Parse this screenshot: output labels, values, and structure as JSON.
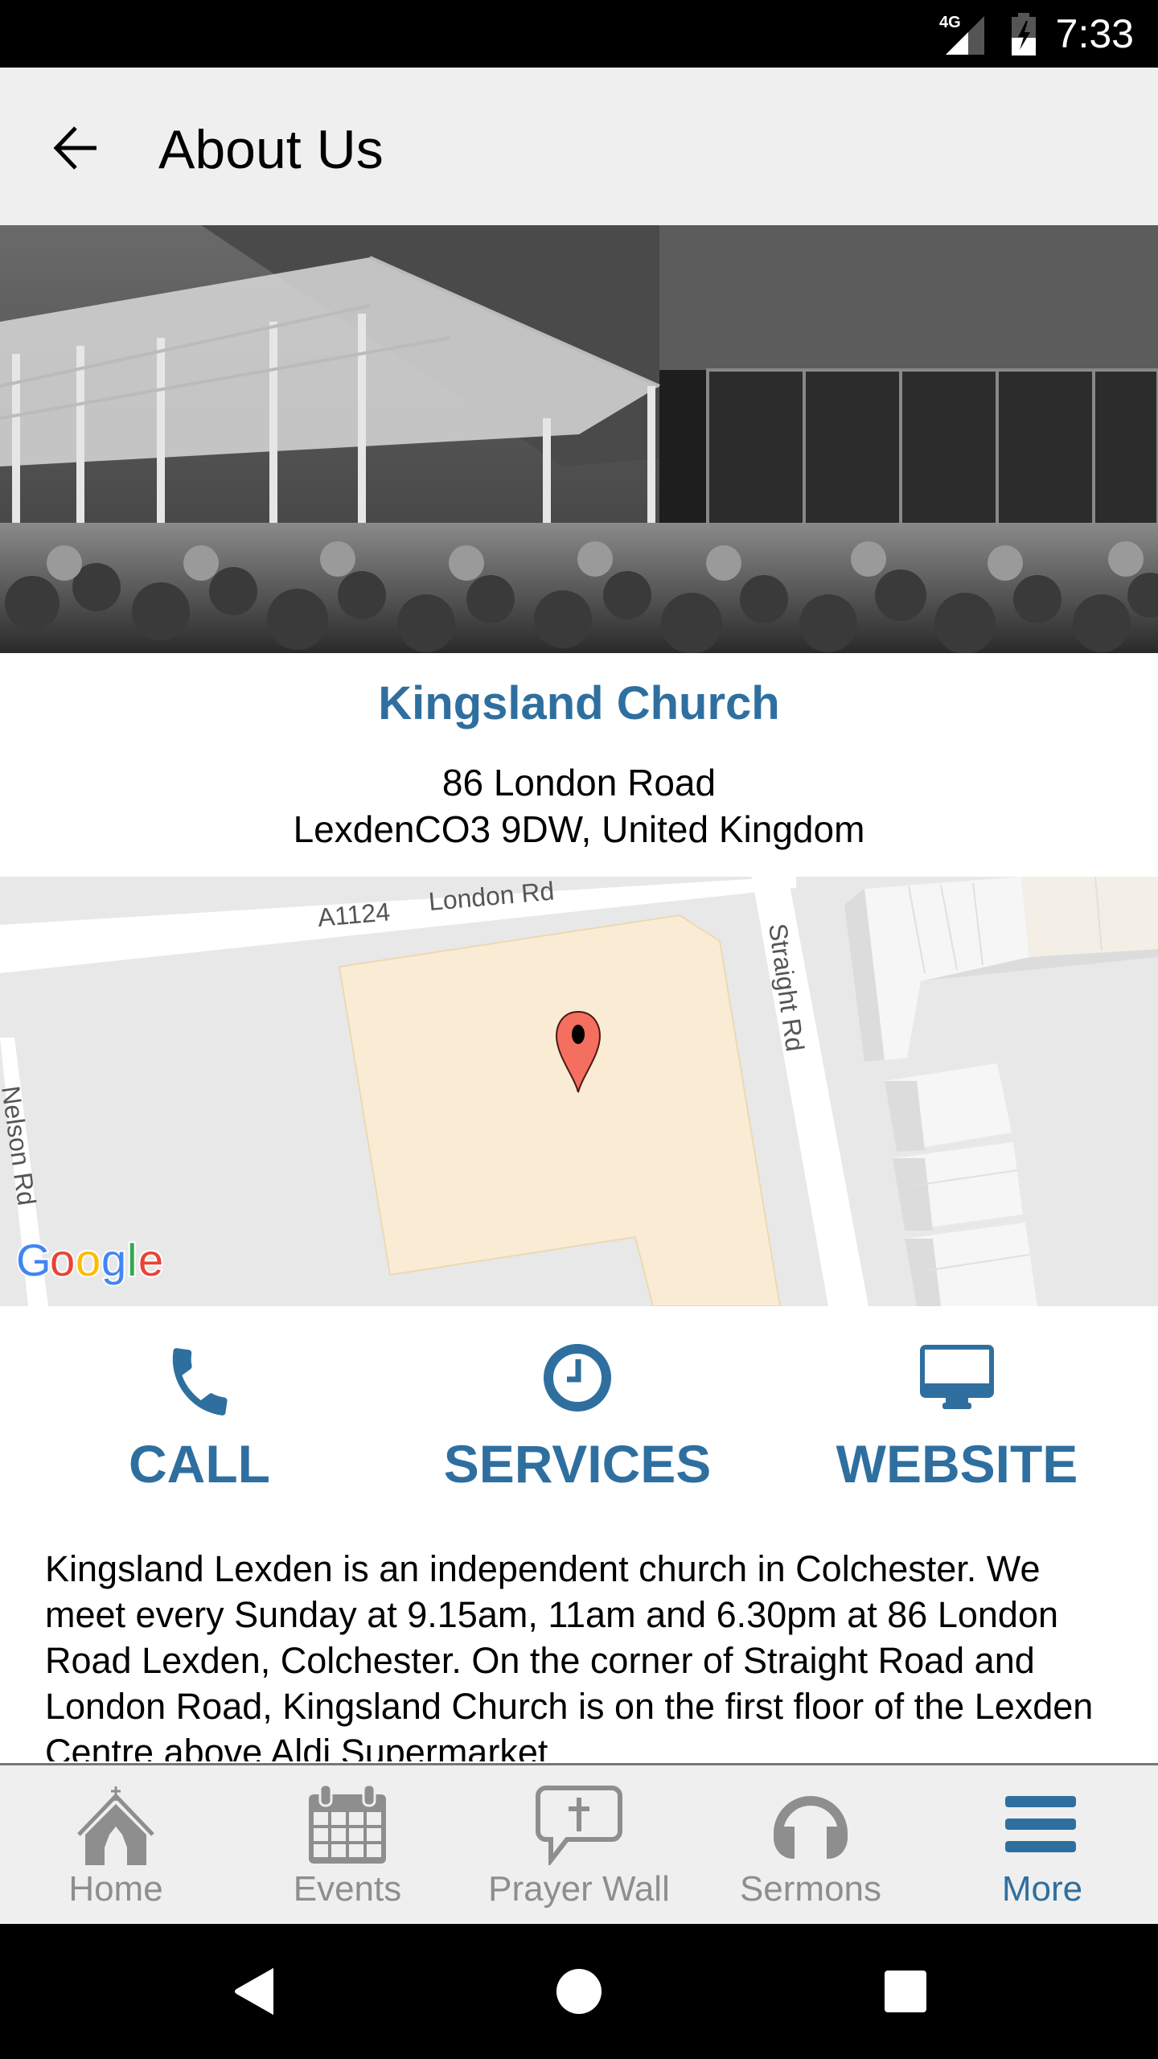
{
  "status_bar": {
    "network": "4G",
    "time": "7:33"
  },
  "app_bar": {
    "title": "About Us",
    "back_icon": "arrow-left-icon"
  },
  "hero": {
    "description": "Black and white photo of a crowd gathered outside the church building"
  },
  "church": {
    "name": "Kingsland Church",
    "address_line1": "86 London Road",
    "address_line2": "LexdenCO3 9DW, United Kingdom"
  },
  "map": {
    "labels": {
      "road_number": "A1124",
      "london_rd": "London Rd",
      "straight_rd": "Straight Rd",
      "nelson_rd": "Nelson Rd"
    },
    "attribution": "Google",
    "marker": "map-pin-icon"
  },
  "actions": [
    {
      "label": "CALL",
      "icon": "phone-icon"
    },
    {
      "label": "SERVICES",
      "icon": "clock-icon"
    },
    {
      "label": "WEBSITE",
      "icon": "monitor-icon"
    }
  ],
  "description": "Kingsland Lexden is an independent church in Colchester. We meet every Sunday at 9.15am, 11am and 6.30pm at 86 London Road Lexden, Colchester. On the corner of Straight Road and London Road, Kingsland Church is on the first floor of the Lexden Centre above Aldi Supermarket",
  "bottom_nav": [
    {
      "label": "Home",
      "icon": "church-icon",
      "active": false
    },
    {
      "label": "Events",
      "icon": "calendar-icon",
      "active": false
    },
    {
      "label": "Prayer Wall",
      "icon": "prayer-bubble-icon",
      "active": false
    },
    {
      "label": "Sermons",
      "icon": "headphones-icon",
      "active": false
    },
    {
      "label": "More",
      "icon": "menu-icon",
      "active": true
    }
  ],
  "colors": {
    "accent": "#2f6f9f",
    "inactive": "#8e8e8e",
    "app_bar_bg": "#efefef",
    "map_building": "#faecd4",
    "map_pin": "#f46f60"
  }
}
